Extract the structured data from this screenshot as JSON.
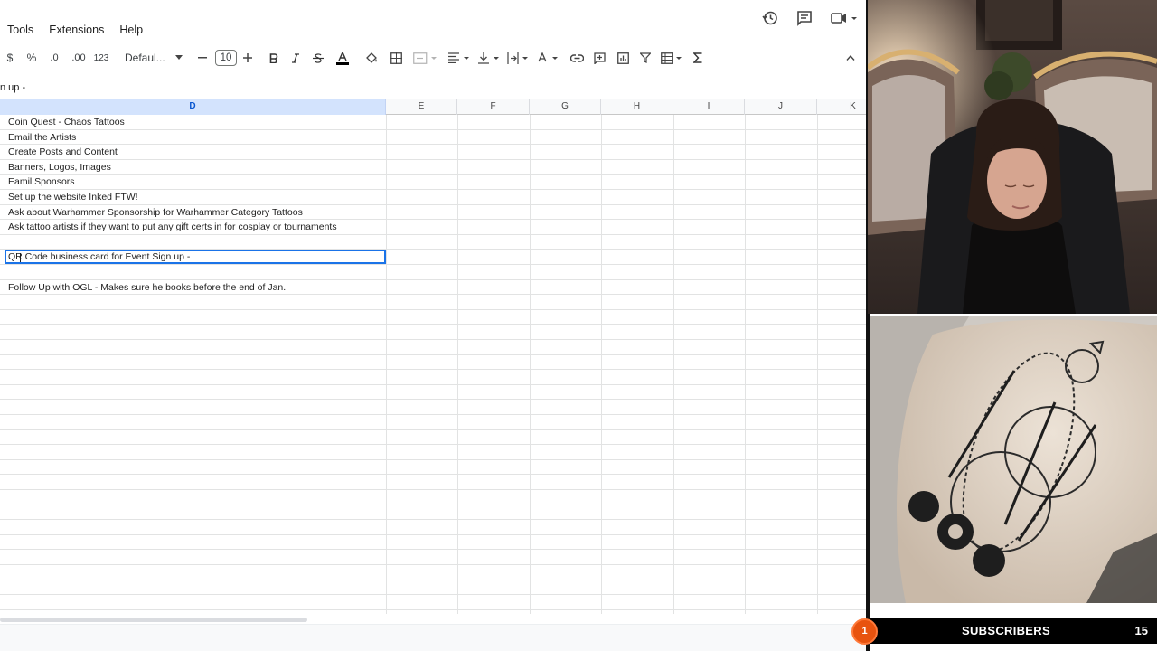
{
  "menu": [
    "Tools",
    "Extensions",
    "Help"
  ],
  "toolbar": {
    "currency": "$",
    "percent": "%",
    "decrease_decimal": ".0",
    "increase_decimal": ".00",
    "number_format": "123",
    "font_family": "Defaul...",
    "font_size": "10"
  },
  "formula_bar": {
    "content": "n up -"
  },
  "columns": [
    "D",
    "E",
    "F",
    "G",
    "H",
    "I",
    "J",
    "K"
  ],
  "selected_column": "D",
  "cells": [
    "Coin Quest - Chaos Tattoos",
    "Email the Artists",
    "Create Posts and Content",
    "Banners, Logos, Images",
    "Eamil Sponsors",
    "Set up the website Inked FTW!",
    "Ask about Warhammer Sponsorship for Warhammer Category Tattoos",
    "Ask tattoo artists if they want to put any gift certs in for cosplay or tournaments",
    "",
    "QR Code business card for Event Sign up -",
    "",
    "Follow Up with OGL - Makes sure he books before the end of Jan."
  ],
  "active_cell_index": 9,
  "subscribers": {
    "badge": "1",
    "label": "SUBSCRIBERS",
    "count": "15"
  },
  "colors": {
    "accent": "#1a73e8",
    "selected_header": "#d3e3fd",
    "badge": "#e8530f"
  }
}
